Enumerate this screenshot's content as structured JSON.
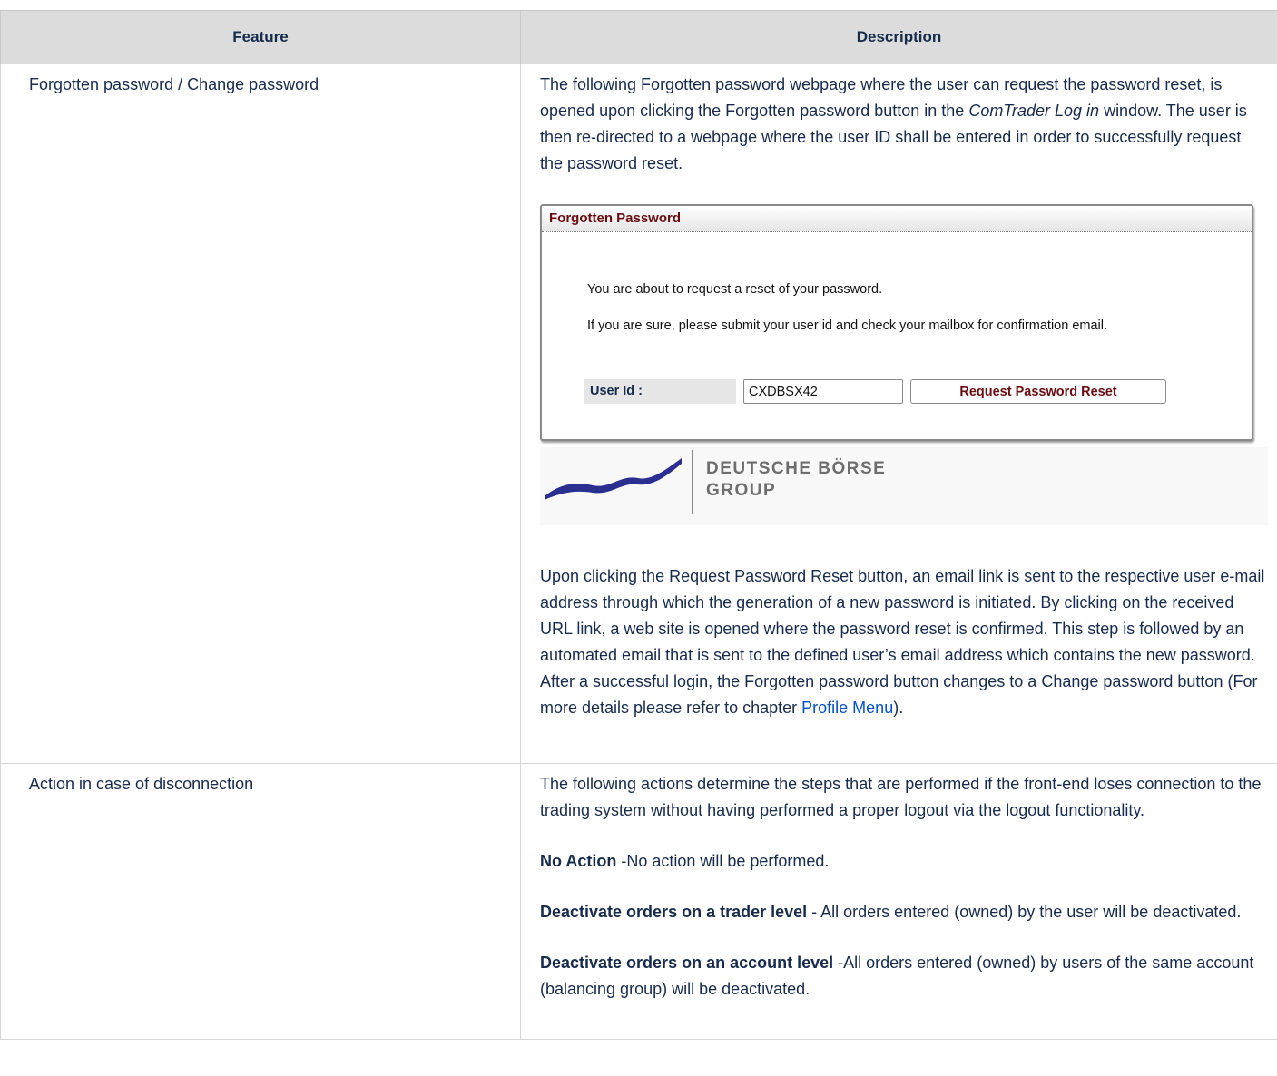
{
  "table": {
    "headers": {
      "feature": "Feature",
      "description": "Description"
    },
    "rows": [
      {
        "feature": "Forgotten password / Change password",
        "intro_before_italic": "The following Forgotten password webpage where the user can request the password reset, is opened upon clicking the Forgotten password button in the ",
        "intro_italic": "ComTrader Log in",
        "intro_after_italic": " window. The user is then re-directed to a webpage where the user ID shall be entered in order to successfully request the password reset.",
        "screenshot": {
          "title": "Forgotten Password",
          "line1": "You are about to request a reset of your password.",
          "line2": "If you are sure, please submit your user id and check your mailbox for confirmation email.",
          "user_id_label": "User Id :",
          "user_id_value": "CXDBSX42",
          "button_label": "Request Password Reset",
          "logo_line1": "DEUTSCHE BÖRSE",
          "logo_line2": "GROUP",
          "logo_color": "#2b2f8f"
        },
        "after_text": "Upon clicking the Request Password Reset button, an email link is sent to the respective user e-mail address through which the generation of a new password is initiated. By clicking on the received URL link, a web site is opened where the password reset is confirmed. This step is followed by an automated email that is sent to the defined user’s email address which contains the new password. After a successful login, the Forgotten password button changes to a Change password button (For more details please refer to chapter ",
        "link_text": "Profile Menu",
        "after_link": ")."
      },
      {
        "feature": "Action in case of disconnection",
        "intro": "The following actions determine the steps that are performed if the front-end loses connection to the trading system without having performed a proper logout via the logout functionality.",
        "options": [
          {
            "bold": "No Action",
            "text": " -No action will be performed."
          },
          {
            "bold": "Deactivate orders on a trader level",
            "text": "  - All orders entered (owned) by the user will be deactivated."
          },
          {
            "bold": "Deactivate orders on an account level",
            "text": "  -All orders entered (owned) by users of the same account (balancing group) will be deactivated."
          }
        ]
      }
    ]
  }
}
